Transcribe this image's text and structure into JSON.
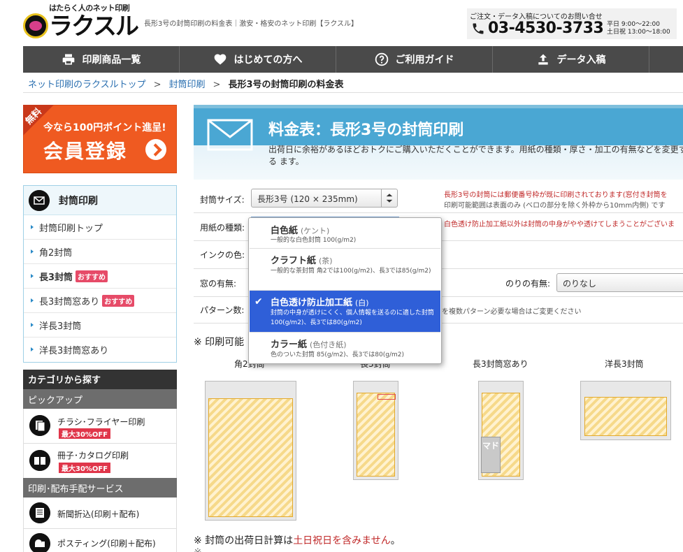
{
  "header": {
    "logo_tagline": "はたらく人のネット印刷",
    "logo_text": "ラクスル",
    "page_description": "長形3号の封筒印刷の料金表｜激安・格安のネット印刷【ラクスル】",
    "contact_label": "ご注文・データ入稿についてのお問い合せ",
    "phone": "03-4530-3733",
    "hours_weekday": "平日 9:00〜22:00",
    "hours_holiday": "土日祝 13:00〜18:00"
  },
  "nav": [
    {
      "label": "印刷商品一覧",
      "icon": "printer-icon"
    },
    {
      "label": "はじめての方へ",
      "icon": "heart-icon"
    },
    {
      "label": "ご利用ガイド",
      "icon": "question-icon"
    },
    {
      "label": "データ入稿",
      "icon": "upload-icon"
    }
  ],
  "breadcrumb": {
    "home": "ネット印刷のラクスルトップ",
    "category": "封筒印刷",
    "current": "長形3号の封筒印刷の料金表",
    "sep": ">"
  },
  "banner": {
    "ribbon": "無料",
    "line1": "今なら100円ポイント進呈!",
    "line2": "会員登録"
  },
  "side_menu": {
    "title": "封筒印刷",
    "items": [
      {
        "label": "封筒印刷トップ",
        "bold": false,
        "badge": ""
      },
      {
        "label": "角2封筒",
        "bold": false,
        "badge": ""
      },
      {
        "label": "長3封筒",
        "bold": true,
        "badge": "おすすめ"
      },
      {
        "label": "長3封筒窓あり",
        "bold": false,
        "badge": "おすすめ"
      },
      {
        "label": "洋長3封筒",
        "bold": false,
        "badge": ""
      },
      {
        "label": "洋長3封筒窓あり",
        "bold": false,
        "badge": ""
      }
    ]
  },
  "categories": {
    "title": "カテゴリから探す",
    "pickup": "ピックアップ",
    "flyer": "チラシ･フライヤー印刷",
    "flyer_badge": "最大30%OFF",
    "booklet": "冊子･カタログ印刷",
    "booklet_badge": "最大30%OFF",
    "distribution": "印刷･配布手配サービス",
    "newspaper": "新聞折込(印刷＋配布)",
    "posting": "ポスティング(印刷＋配布)"
  },
  "main": {
    "title": "料金表：長形3号の封筒印刷",
    "description": "出荷日に余裕があるほどおトクにご購入いただくことができます。用紙の種類・厚さ・加工の有無などを変更する ます。",
    "size_label": "封筒サイズ:",
    "size_value": "長形3号 (120 × 235mm)",
    "paper_label": "用紙の種類:",
    "ink_label": "インクの色:",
    "window_label": "窓の有無:",
    "nori_label": "のりの有無:",
    "nori_value": "のりなし",
    "pattern_label": "パターン数:",
    "note_size_red": "長形3号の封筒には郵便番号枠が既に印刷されております(窓付き封筒を",
    "note_size_gray": "印刷可能範囲は表面のみ (ベロの部分を除く外枠から10mm内側) です",
    "note_paper_red": "白色透け防止加工紙以外は封筒の中身がやや透けてしまうことがございま",
    "pattern_note": "物を複数パターン必要な場合はご変更ください",
    "printable_heading": "※ 印刷可能"
  },
  "envelopes": [
    "角2封筒",
    "長3封筒",
    "長3封筒窓あり",
    "洋長3封筒"
  ],
  "madoari_text": "マド",
  "dropdown": {
    "options": [
      {
        "title": "白色紙",
        "sub": "(ケント)",
        "desc": "一般的な白色封筒 100(g/m2)",
        "selected": false
      },
      {
        "title": "クラフト紙",
        "sub": "(茶)",
        "desc": "一般的な茶封筒 角2では100(g/m2)、長3では85(g/m2)",
        "selected": false
      },
      {
        "title": "白色透け防止加工紙",
        "sub": "(白)",
        "desc": "封筒の中身が透けにくく、個人情報を送るのに適した封筒 100(g/m2)、長3では80(g/m2)",
        "selected": true
      },
      {
        "title": "カラー紙",
        "sub": "(色付き紙)",
        "desc": "色のついた封筒 85(g/m2)、長3では80(g/m2)",
        "selected": false
      }
    ],
    "check": "✔"
  },
  "footer_notes": {
    "ship_prefix": "※ 封筒の出荷日計算は",
    "ship_red": "土日祝日を含みません",
    "ship_suffix": "。",
    "next": "※ ..."
  }
}
